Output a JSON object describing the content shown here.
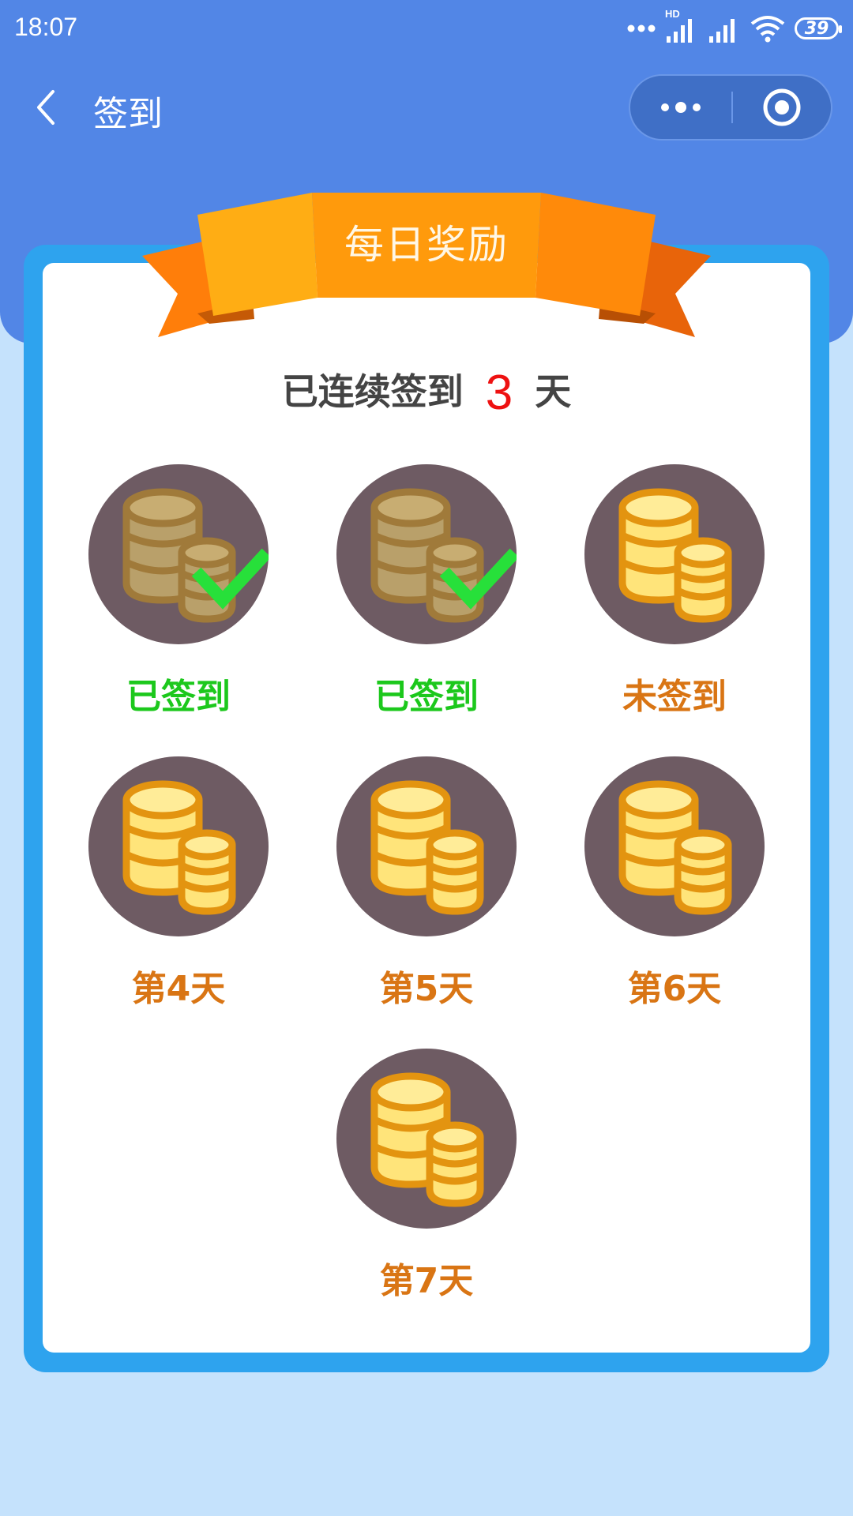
{
  "status_bar": {
    "time": "18:07",
    "network_tag": "HD",
    "battery": "39"
  },
  "nav": {
    "title": "签到",
    "back_icon": "chevron-left-icon",
    "more_icon": "more-dots-icon",
    "close_icon": "target-close-icon"
  },
  "banner": {
    "title": "每日奖励"
  },
  "streak": {
    "prefix": "已连续签到",
    "count": "3",
    "suffix": "天"
  },
  "days": [
    {
      "label": "已签到",
      "status": "signed",
      "checked": true
    },
    {
      "label": "已签到",
      "status": "signed",
      "checked": true
    },
    {
      "label": "未签到",
      "status": "unsigned",
      "checked": false
    },
    {
      "label": "第4天",
      "status": "upcoming",
      "checked": false
    },
    {
      "label": "第5天",
      "status": "upcoming",
      "checked": false
    },
    {
      "label": "第6天",
      "status": "upcoming",
      "checked": false
    },
    {
      "label": "第7天",
      "status": "upcoming",
      "checked": false
    }
  ],
  "colors": {
    "header": "#5286e6",
    "card_border": "#2ea3ee",
    "page_bg": "#c5e2fc",
    "coin_circle": "#6e5b63",
    "signed_label": "#1cc81c",
    "unsigned_label": "#d97514",
    "streak_count": "#ee1111",
    "ribbon": "#ff9a0c"
  }
}
